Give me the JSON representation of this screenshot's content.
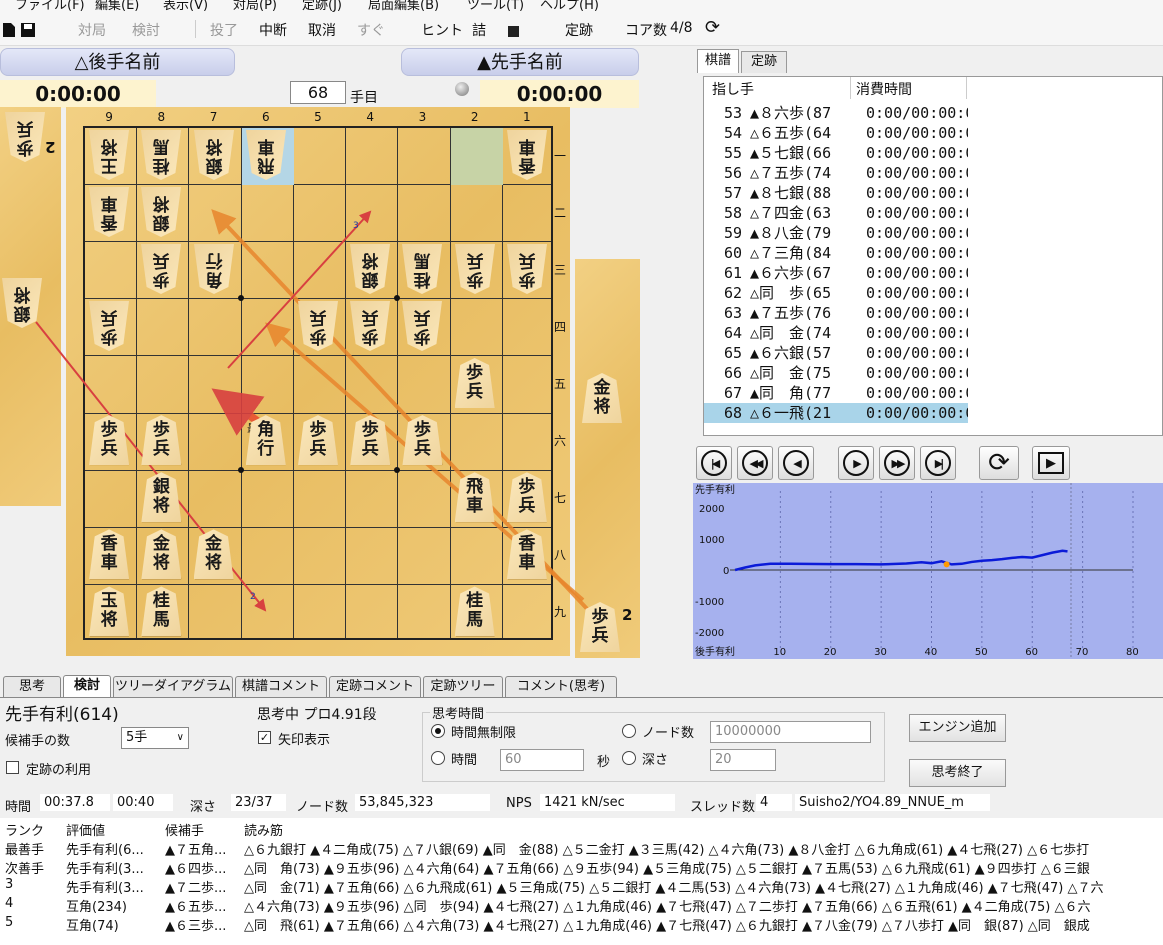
{
  "menu": [
    "ファイル(F)",
    "編集(E)",
    "表示(V)",
    "対局(P)",
    "定跡(J)",
    "局面編集(B)",
    "ツール(T)",
    "ヘルプ(H)"
  ],
  "toolbar": {
    "taikyoku": "対局",
    "kento": "検討",
    "touryo": "投了",
    "chudan": "中断",
    "torikeshi": "取消",
    "sugu": "すぐ",
    "hint": "ヒント",
    "tsume": "詰",
    "joseki": "定跡",
    "core": "コア数",
    "core_val": "4/8"
  },
  "players": {
    "gote_name": "△後手名前",
    "sente_name": "▲先手名前",
    "gote_time": "0:00:00",
    "sente_time": "0:00:00",
    "move_no": "68",
    "move_suffix": "手目"
  },
  "files": [
    "9",
    "8",
    "7",
    "6",
    "5",
    "4",
    "3",
    "2",
    "1"
  ],
  "ranks": [
    "一",
    "二",
    "三",
    "四",
    "五",
    "六",
    "七",
    "八",
    "九"
  ],
  "board": [
    {
      "f": 9,
      "r": 1,
      "c": "王将",
      "gote": true
    },
    {
      "f": 8,
      "r": 1,
      "c": "桂馬",
      "gote": true
    },
    {
      "f": 7,
      "r": 1,
      "c": "銀将",
      "gote": true
    },
    {
      "f": 6,
      "r": 1,
      "c": "飛車",
      "gote": true
    },
    {
      "f": 1,
      "r": 1,
      "c": "香車",
      "gote": true
    },
    {
      "f": 9,
      "r": 2,
      "c": "香車",
      "gote": true
    },
    {
      "f": 8,
      "r": 2,
      "c": "銀将",
      "gote": true
    },
    {
      "f": 8,
      "r": 3,
      "c": "歩兵",
      "gote": true
    },
    {
      "f": 7,
      "r": 3,
      "c": "角行",
      "gote": true
    },
    {
      "f": 4,
      "r": 3,
      "c": "銀将",
      "gote": true
    },
    {
      "f": 3,
      "r": 3,
      "c": "桂馬",
      "gote": true
    },
    {
      "f": 2,
      "r": 3,
      "c": "歩兵",
      "gote": true
    },
    {
      "f": 1,
      "r": 3,
      "c": "歩兵",
      "gote": true
    },
    {
      "f": 9,
      "r": 4,
      "c": "歩兵",
      "gote": true
    },
    {
      "f": 5,
      "r": 4,
      "c": "歩兵",
      "gote": true
    },
    {
      "f": 4,
      "r": 4,
      "c": "歩兵",
      "gote": true
    },
    {
      "f": 3,
      "r": 4,
      "c": "歩兵",
      "gote": true
    },
    {
      "f": 2,
      "r": 5,
      "c": "歩兵",
      "gote": false
    },
    {
      "f": 9,
      "r": 6,
      "c": "歩兵",
      "gote": false
    },
    {
      "f": 8,
      "r": 6,
      "c": "歩兵",
      "gote": false
    },
    {
      "f": 6,
      "r": 6,
      "c": "角行",
      "gote": false
    },
    {
      "f": 5,
      "r": 6,
      "c": "歩兵",
      "gote": false
    },
    {
      "f": 4,
      "r": 6,
      "c": "歩兵",
      "gote": false
    },
    {
      "f": 3,
      "r": 6,
      "c": "歩兵",
      "gote": false
    },
    {
      "f": 8,
      "r": 7,
      "c": "銀将",
      "gote": false
    },
    {
      "f": 2,
      "r": 7,
      "c": "飛車",
      "gote": false
    },
    {
      "f": 1,
      "r": 7,
      "c": "歩兵",
      "gote": false
    },
    {
      "f": 9,
      "r": 8,
      "c": "香車",
      "gote": false
    },
    {
      "f": 8,
      "r": 8,
      "c": "金将",
      "gote": false
    },
    {
      "f": 7,
      "r": 8,
      "c": "金将",
      "gote": false
    },
    {
      "f": 1,
      "r": 8,
      "c": "香車",
      "gote": false
    },
    {
      "f": 9,
      "r": 9,
      "c": "玉将",
      "gote": false
    },
    {
      "f": 8,
      "r": 9,
      "c": "桂馬",
      "gote": false
    },
    {
      "f": 2,
      "r": 9,
      "c": "桂馬",
      "gote": false
    }
  ],
  "gote_hand": [
    {
      "c": "歩兵",
      "n": "2"
    },
    {
      "c": "銀将",
      "n": ""
    }
  ],
  "sente_hand": [
    {
      "c": "金将",
      "n": ""
    },
    {
      "c": "歩兵",
      "n": "2"
    }
  ],
  "arrow_labels": {
    "best": "最",
    "n3": "3",
    "n2": "2"
  },
  "tabs_top": [
    "棋譜",
    "定跡"
  ],
  "kifu_headers": [
    "指し手",
    "消費時間"
  ],
  "kifu": [
    {
      "no": "53",
      "mv": "▲８六歩(87",
      "t": "0:00/00:00:0"
    },
    {
      "no": "54",
      "mv": "△６五歩(64",
      "t": "0:00/00:00:0"
    },
    {
      "no": "55",
      "mv": "▲５七銀(66",
      "t": "0:00/00:00:0"
    },
    {
      "no": "56",
      "mv": "△７五歩(74",
      "t": "0:00/00:00:0"
    },
    {
      "no": "57",
      "mv": "▲８七銀(88",
      "t": "0:00/00:00:0"
    },
    {
      "no": "58",
      "mv": "△７四金(63",
      "t": "0:00/00:00:0"
    },
    {
      "no": "59",
      "mv": "▲８八金(79",
      "t": "0:00/00:00:0"
    },
    {
      "no": "60",
      "mv": "△７三角(84",
      "t": "0:00/00:00:0"
    },
    {
      "no": "61",
      "mv": "▲６六歩(67",
      "t": "0:00/00:00:0"
    },
    {
      "no": "62",
      "mv": "△同　歩(65",
      "t": "0:00/00:00:0"
    },
    {
      "no": "63",
      "mv": "▲７五歩(76",
      "t": "0:00/00:00:0"
    },
    {
      "no": "64",
      "mv": "△同　金(74",
      "t": "0:00/00:00:0"
    },
    {
      "no": "65",
      "mv": "▲６六銀(57",
      "t": "0:00/00:00:0"
    },
    {
      "no": "66",
      "mv": "△同　金(75",
      "t": "0:00/00:00:0"
    },
    {
      "no": "67",
      "mv": "▲同　角(77",
      "t": "0:00/00:00:0"
    },
    {
      "no": "68",
      "mv": "△６一飛(21",
      "t": "0:00/00:00:0"
    }
  ],
  "graph": {
    "title": "先手有利",
    "bottom": "後手有利",
    "yticks": [
      "2000",
      "1000",
      "0",
      "-1000",
      "-2000"
    ],
    "xticks": [
      "10",
      "20",
      "30",
      "40",
      "50",
      "60",
      "70",
      "80"
    ]
  },
  "tabs_bottom": [
    "思考",
    "検討",
    "ツリーダイアグラム",
    "棋譜コメント",
    "定跡コメント",
    "定跡ツリー",
    "コメント(思考)"
  ],
  "engine": {
    "eval": "先手有利(614)",
    "thinking": "思考中 プロ4.91段",
    "candidates_label": "候補手の数",
    "candidates": "5手",
    "arrow_label": "矢印表示",
    "joseki_label": "定跡の利用",
    "think_time": "思考時間",
    "unlimited": "時間無制限",
    "time": "時間",
    "time_val": "60",
    "sec": "秒",
    "nodes": "ノード数",
    "nodes_val": "10000000",
    "depth": "深さ",
    "depth_val": "20",
    "add_engine": "エンジン追加",
    "stop": "思考終了"
  },
  "status": {
    "time_l": "時間",
    "time_v": "00:37.8",
    "time_v2": "00:40",
    "depth_l": "深さ",
    "depth_v": "23/37",
    "nodes_l": "ノード数",
    "nodes_v": "53,845,323",
    "nps_l": "NPS",
    "nps_v": "1421 kN/sec",
    "thread_l": "スレッド数",
    "thread_v": "4",
    "engine_v": "Suisho2/YO4.89_NNUE_m"
  },
  "table": {
    "headers": [
      "ランク",
      "評価値",
      "候補手",
      "読み筋"
    ],
    "rows": [
      [
        "最善手",
        "先手有利(6...",
        "▲７五角...",
        "△６九銀打 ▲４二角成(75) △７八銀(69) ▲同　金(88) △５二金打 ▲３三馬(42) △４六角(73) ▲８八金打 △６九角成(61) ▲４七飛(27) △６七歩打"
      ],
      [
        "次善手",
        "先手有利(3...",
        "▲６四歩...",
        "△同　角(73) ▲９五歩(96) △４六角(64) ▲７五角(66) △９五歩(94) ▲５三角成(75) △５二銀打 ▲７五馬(53) △６九飛成(61) ▲９四歩打 △６三銀"
      ],
      [
        "3",
        "先手有利(3...",
        "▲７二歩...",
        "△同　金(71) ▲７五角(66) △６九飛成(61) ▲５三角成(75) △５二銀打 ▲４二馬(53) △４六角(73) ▲４七飛(27) △１九角成(46) ▲７七飛(47) △７六"
      ],
      [
        "4",
        "互角(234)",
        "▲６五歩...",
        "△４六角(73) ▲９五歩(96) △同　歩(94) ▲４七飛(27) △１九角成(46) ▲７七飛(47) △７二歩打 ▲７五角(66) △６五飛(61) ▲４二角成(75) △６六"
      ],
      [
        "5",
        "互角(74)",
        "▲６三歩...",
        "△同　飛(61) ▲７五角(66) △４六角(73) ▲４七飛(27) △１九角成(46) ▲７七飛(47) △６九銀打 ▲７八金(79) △７八歩打 ▲同　銀(87) △同　銀成"
      ]
    ]
  }
}
